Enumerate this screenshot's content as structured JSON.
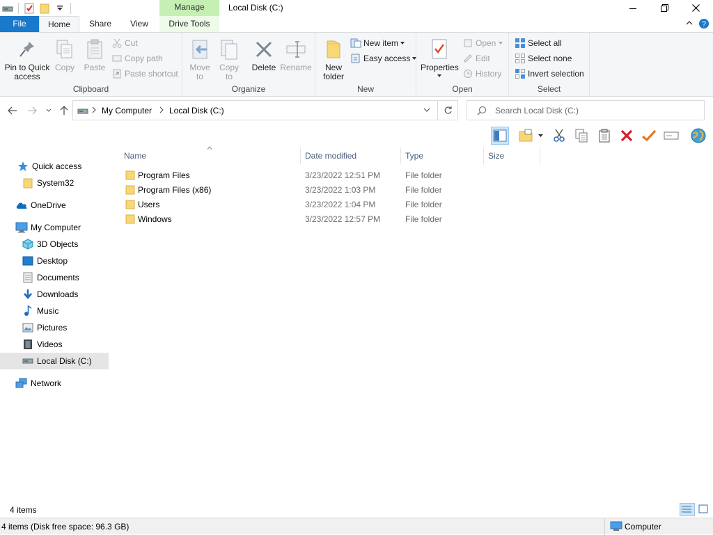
{
  "window": {
    "title": "Local Disk (C:)",
    "contextual_tab": "Manage"
  },
  "tabs": {
    "file": "File",
    "home": "Home",
    "share": "Share",
    "view": "View",
    "drive_tools": "Drive Tools"
  },
  "ribbon": {
    "clipboard": {
      "label": "Clipboard",
      "pin_line1": "Pin to Quick",
      "pin_line2": "access",
      "copy": "Copy",
      "paste": "Paste",
      "cut": "Cut",
      "copy_path": "Copy path",
      "paste_shortcut": "Paste shortcut"
    },
    "organize": {
      "label": "Organize",
      "move_line1": "Move",
      "move_line2": "to",
      "copy_line1": "Copy",
      "copy_line2": "to",
      "delete": "Delete",
      "rename": "Rename"
    },
    "new": {
      "label": "New",
      "folder_line1": "New",
      "folder_line2": "folder",
      "new_item": "New item",
      "easy_access": "Easy access"
    },
    "open": {
      "label": "Open",
      "properties": "Properties",
      "open": "Open",
      "edit": "Edit",
      "history": "History"
    },
    "select": {
      "label": "Select",
      "select_all": "Select all",
      "select_none": "Select none",
      "invert": "Invert selection"
    }
  },
  "address": {
    "crumbs": [
      "My Computer",
      "Local Disk (C:)"
    ],
    "search_placeholder": "Search Local Disk (C:)"
  },
  "nav": {
    "quick_access": "Quick access",
    "system32": "System32",
    "onedrive": "OneDrive",
    "my_computer": "My Computer",
    "objects3d": "3D Objects",
    "desktop": "Desktop",
    "documents": "Documents",
    "downloads": "Downloads",
    "music": "Music",
    "pictures": "Pictures",
    "videos": "Videos",
    "local_disk": "Local Disk (C:)",
    "network": "Network"
  },
  "columns": {
    "name": "Name",
    "date": "Date modified",
    "type": "Type",
    "size": "Size"
  },
  "files": [
    {
      "name": "Program Files",
      "date": "3/23/2022 12:51 PM",
      "type": "File folder"
    },
    {
      "name": "Program Files (x86)",
      "date": "3/23/2022 1:03 PM",
      "type": "File folder"
    },
    {
      "name": "Users",
      "date": "3/23/2022 1:04 PM",
      "type": "File folder"
    },
    {
      "name": "Windows",
      "date": "3/23/2022 12:57 PM",
      "type": "File folder"
    }
  ],
  "status": {
    "item_count": "4 items",
    "bottom_left": "4 items (Disk free space: 96.3 GB)",
    "bottom_right": "Computer"
  },
  "colors": {
    "file_tab": "#1979ca",
    "manage_tab": "#c6efb4",
    "folder_yellow": "#f8d775",
    "selected_nav": "#e5e5e5"
  }
}
